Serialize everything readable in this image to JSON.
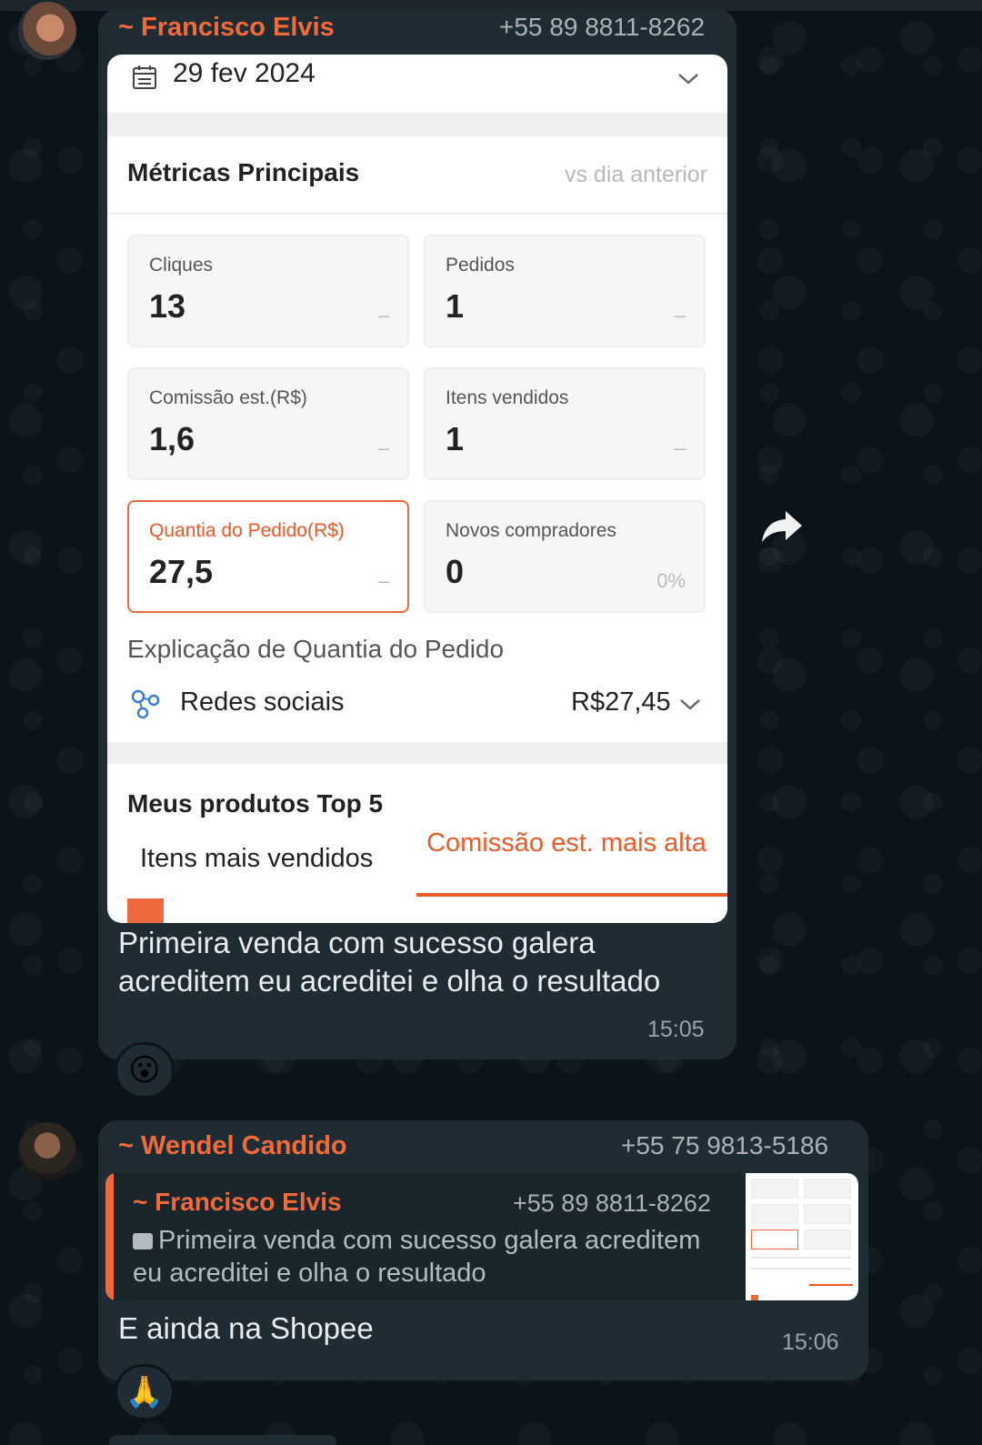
{
  "colors": {
    "chat_background": "#0b141a",
    "bubble": "#1f2c34",
    "sender_name": "#f26a3a",
    "accent_orange": "#ee5a2a"
  },
  "message1": {
    "sender_name": "~ Francisco Elvis",
    "sender_phone": "+55 89 8811-8262",
    "screenshot": {
      "date": "29 fev 2024",
      "metrics_title": "Métricas Principais",
      "comparison_label": "vs dia anterior",
      "metrics": [
        {
          "label": "Cliques",
          "value": "13",
          "delta": "–"
        },
        {
          "label": "Pedidos",
          "value": "1",
          "delta": "–"
        },
        {
          "label": "Comissão est.(R$)",
          "value": "1,6",
          "delta": "–"
        },
        {
          "label": "Itens vendidos",
          "value": "1",
          "delta": "–"
        },
        {
          "label": "Quantia do Pedido(R$)",
          "value": "27,5",
          "delta": "–"
        },
        {
          "label": "Novos compradores",
          "value": "0",
          "delta": "0%"
        }
      ],
      "explanation_title": "Explicação de Quantia do Pedido",
      "channel_label": "Redes sociais",
      "channel_value": "R$27,45",
      "top_products_title": "Meus produtos Top 5",
      "tab_best_sellers": "Itens mais vendidos",
      "tab_highest_commission": "Comissão est. mais alta"
    },
    "text": "Primeira venda com sucesso galera acreditem eu acreditei e olha o resultado",
    "time": "15:05",
    "reaction": "😮"
  },
  "message2": {
    "sender_name": "~ Wendel Candido",
    "sender_phone": "+55 75 9813-5186",
    "quoted": {
      "sender_name": "~ Francisco Elvis",
      "sender_phone": "+55 89 8811-8262",
      "text": "Primeira venda com sucesso galera acreditem eu acreditei e olha o resultado"
    },
    "text": "E ainda na Shopee",
    "time": "15:06",
    "reaction": "🙏"
  }
}
